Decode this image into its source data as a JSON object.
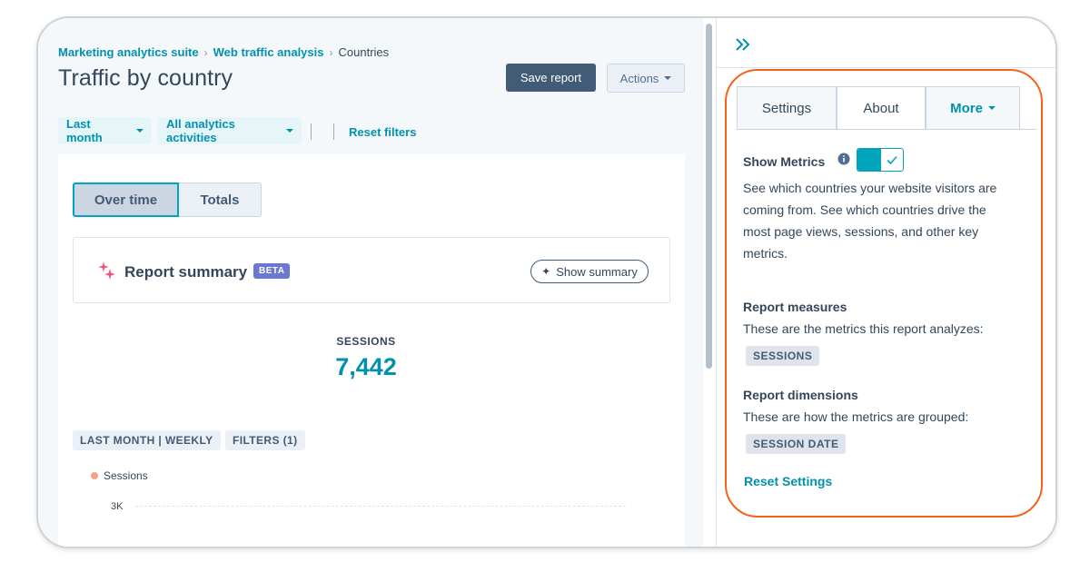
{
  "breadcrumb": {
    "items": [
      "Marketing analytics suite",
      "Web traffic analysis"
    ],
    "current": "Countries"
  },
  "page": {
    "title": "Traffic by country",
    "save_label": "Save report",
    "actions_label": "Actions"
  },
  "filters": {
    "date_label": "Last month",
    "activities_label": "All analytics activities",
    "reset_label": "Reset filters"
  },
  "view_toggle": {
    "options": [
      "Over time",
      "Totals"
    ],
    "selected": "Over time"
  },
  "summary": {
    "title": "Report summary",
    "badge": "BETA",
    "button_label": "Show summary"
  },
  "metric": {
    "label": "SESSIONS",
    "value": "7,442"
  },
  "tags": {
    "period": "LAST MONTH | WEEKLY",
    "filters": "FILTERS (1)"
  },
  "chart": {
    "legend": "Sessions",
    "y_tick": "3K",
    "series_color": "#f2a28b"
  },
  "sidebar": {
    "tabs": [
      "Settings",
      "About",
      "More"
    ],
    "active_tab": "About",
    "show_metrics_label": "Show Metrics",
    "show_metrics_enabled": true,
    "description": "See which countries your website visitors are coming from. See which countries drive the most page views, sessions, and other key metrics.",
    "measures_heading": "Report measures",
    "measures_text": "These are the metrics this report analyzes:",
    "measures_tag": "SESSIONS",
    "dimensions_heading": "Report dimensions",
    "dimensions_text": "These are how the metrics are grouped:",
    "dimensions_tag": "SESSION DATE",
    "reset_label": "Reset Settings"
  },
  "colors": {
    "accent": "#0091ae",
    "primary_button": "#425b76",
    "highlight": "#f5621b",
    "badge": "#6a78d1"
  }
}
